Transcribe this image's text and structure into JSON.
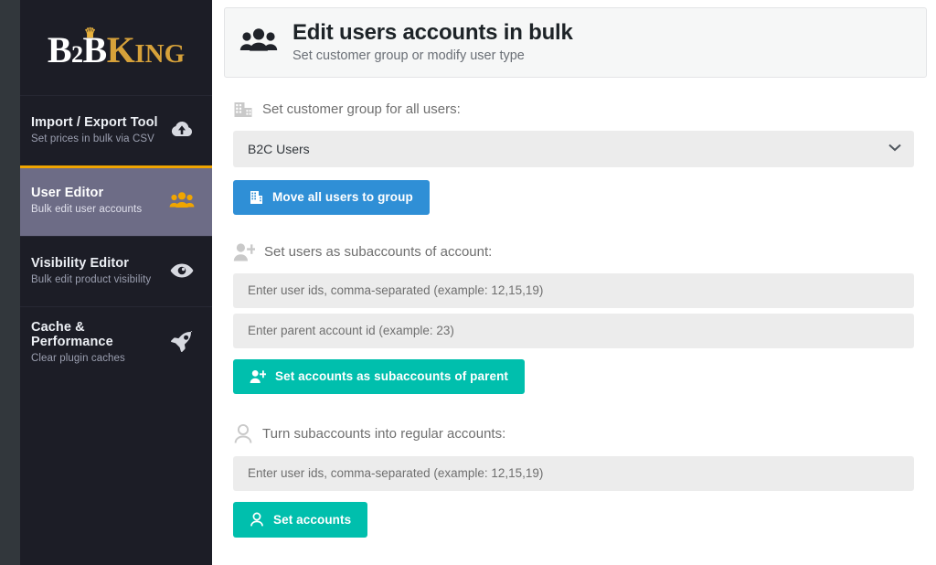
{
  "brand": {
    "logo_b": "B",
    "logo_2": "2",
    "logo_b2": "B",
    "logo_k": "K",
    "logo_ing": "ING",
    "crown_icon": "crown-icon"
  },
  "sidebar": {
    "items": [
      {
        "title": "Import / Export Tool",
        "subtitle": "Set prices in bulk via CSV",
        "icon": "cloud-upload-icon",
        "active": false
      },
      {
        "title": "User Editor",
        "subtitle": "Bulk edit user accounts",
        "icon": "users-group-icon",
        "active": true
      },
      {
        "title": "Visibility Editor",
        "subtitle": "Bulk edit product visibility",
        "icon": "eye-icon",
        "active": false
      },
      {
        "title": "Cache & Performance",
        "subtitle": "Clear plugin caches",
        "icon": "rocket-icon",
        "active": false
      }
    ]
  },
  "header": {
    "icon": "users-group-icon",
    "title": "Edit users accounts in bulk",
    "subtitle": "Set customer group or modify user type"
  },
  "sections": {
    "customer_group": {
      "label": "Set customer group for all users:",
      "label_icon": "building-icon",
      "select_value": "B2C Users",
      "select_chevron": "chevron-down-icon",
      "button_label": "Move all users to group",
      "button_icon": "building-icon",
      "button_color": "#2f8fd6"
    },
    "subaccounts": {
      "label": "Set users as subaccounts of account:",
      "label_icon": "user-plus-icon",
      "user_ids_placeholder": "Enter user ids, comma-separated (example: 12,15,19)",
      "parent_id_placeholder": "Enter parent account id (example: 23)",
      "button_label": "Set accounts as subaccounts of parent",
      "button_icon": "user-plus-icon",
      "button_color": "#00bfad"
    },
    "regular_accounts": {
      "label": "Turn subaccounts into regular accounts:",
      "label_icon": "user-outline-icon",
      "user_ids_placeholder": "Enter user ids, comma-separated (example: 12,15,19)",
      "button_label": "Set accounts",
      "button_icon": "user-outline-icon",
      "button_color": "#00bfad"
    }
  },
  "colors": {
    "accent_orange": "#f0a500",
    "sidebar_bg": "#1c1d26",
    "active_bg": "#6d6c86",
    "blue": "#2f8fd6",
    "teal": "#00bfad"
  }
}
